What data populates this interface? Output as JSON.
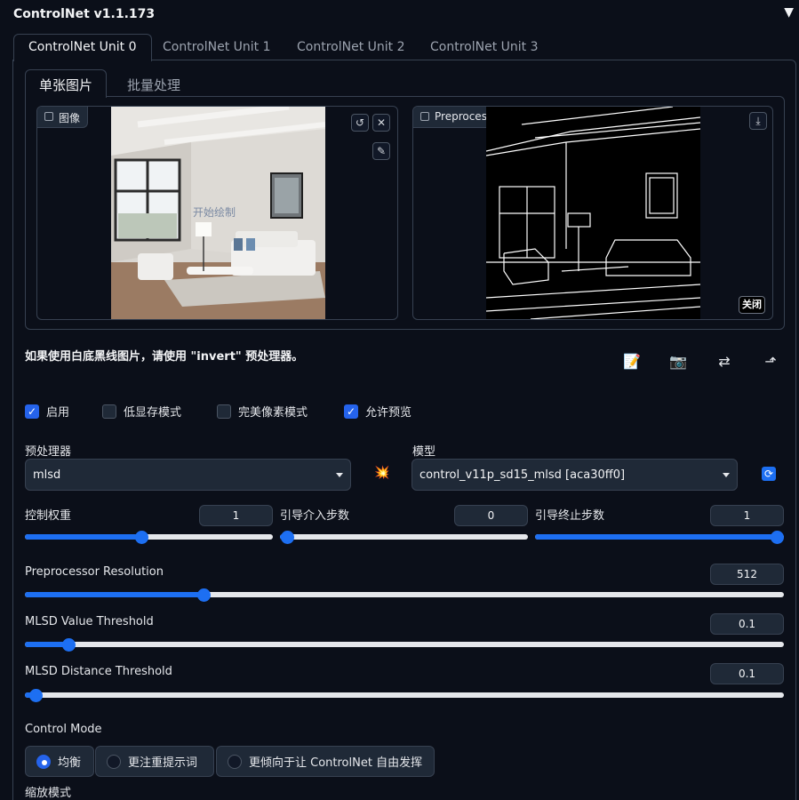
{
  "app": {
    "title": "ControlNet v1.1.173",
    "collapse_icon": "▼"
  },
  "unit_tabs": [
    "ControlNet Unit 0",
    "ControlNet Unit 1",
    "ControlNet Unit 2",
    "ControlNet Unit 3"
  ],
  "input_tabs": [
    "单张图片",
    "批量处理"
  ],
  "image_panel": {
    "label": "图像",
    "overlay_text": "开始绘制"
  },
  "preview_panel": {
    "label": "Preprocessor Preview",
    "close_label": "关闭"
  },
  "hint": "如果使用白底黑线图片，请使用 \"invert\" 预处理器。",
  "checkboxes": [
    {
      "label": "启用",
      "checked": true
    },
    {
      "label": "低显存模式",
      "checked": false
    },
    {
      "label": "完美像素模式",
      "checked": false
    },
    {
      "label": "允许预览",
      "checked": true
    }
  ],
  "preprocessor": {
    "label": "预处理器",
    "value": "mlsd"
  },
  "model": {
    "label": "模型",
    "value": "control_v11p_sd15_mlsd [aca30ff0]"
  },
  "sliders": {
    "weight": {
      "label": "控制权重",
      "value": "1",
      "fraction": 0.47
    },
    "start": {
      "label": "引导介入步数",
      "value": "0",
      "fraction": 0.0
    },
    "end": {
      "label": "引导终止步数",
      "value": "1",
      "fraction": 1.0
    },
    "resolution": {
      "label": "Preprocessor Resolution",
      "value": "512",
      "fraction": 0.231
    },
    "value_threshold": {
      "label": "MLSD Value Threshold",
      "value": "0.1",
      "fraction": 0.05
    },
    "distance_threshold": {
      "label": "MLSD Distance Threshold",
      "value": "0.1",
      "fraction": 0.005
    }
  },
  "control_mode": {
    "label": "Control Mode",
    "options": [
      {
        "label": "均衡",
        "selected": true
      },
      {
        "label": "更注重提示词",
        "selected": false
      },
      {
        "label": "更倾向于让 ControlNet 自由发挥",
        "selected": false
      }
    ]
  },
  "resize_mode": {
    "label": "缩放模式"
  },
  "colors": {
    "accent": "#2563eb",
    "bg": "#0b0f19",
    "panel": "#1f2937",
    "border": "#374151"
  }
}
